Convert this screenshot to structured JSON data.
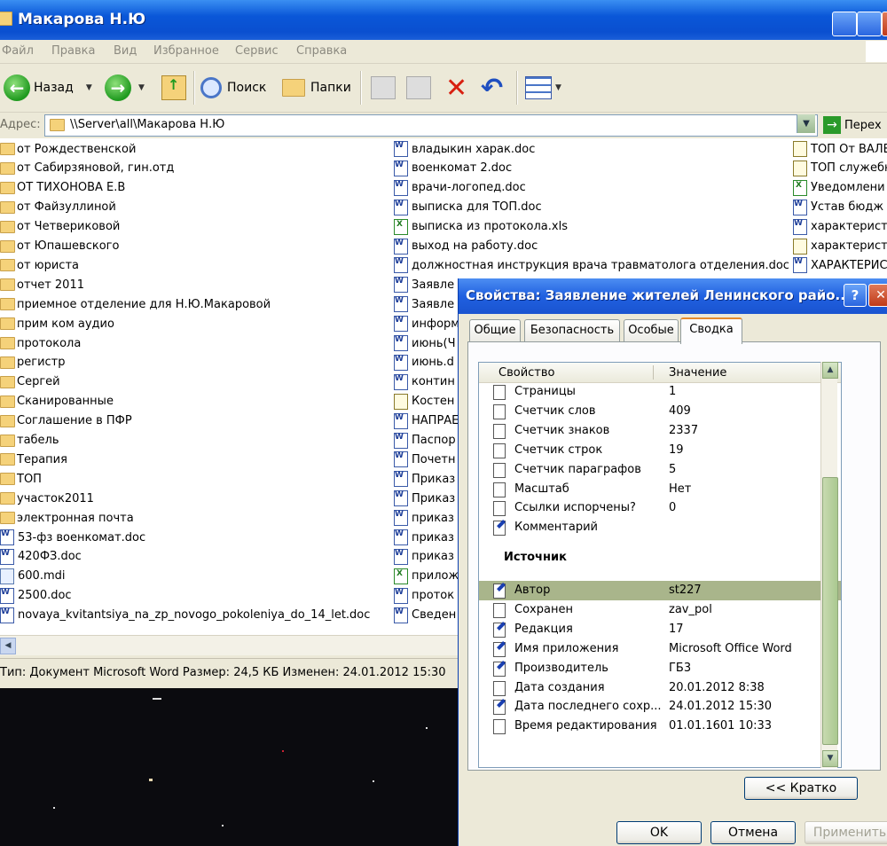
{
  "window": {
    "title": "Макарова Н.Ю"
  },
  "menu": [
    "Файл",
    "Правка",
    "Вид",
    "Избранное",
    "Сервис",
    "Справка"
  ],
  "toolbar": {
    "back": "Назад",
    "search": "Поиск",
    "folders": "Папки"
  },
  "address": {
    "label": "Адрес:",
    "path": "\\\\Server\\all\\Макарова Н.Ю",
    "go": "Перех"
  },
  "files_col1": [
    {
      "name": "от Рождественской",
      "type": "folder"
    },
    {
      "name": "от Сабирзяновой, гин.отд",
      "type": "folder"
    },
    {
      "name": "ОТ ТИХОНОВА Е.В",
      "type": "folder"
    },
    {
      "name": "от Файзуллиной",
      "type": "folder"
    },
    {
      "name": "от Четвериковой",
      "type": "folder"
    },
    {
      "name": "от Юпашевского",
      "type": "folder"
    },
    {
      "name": "от юриста",
      "type": "folder"
    },
    {
      "name": "отчет 2011",
      "type": "folder"
    },
    {
      "name": "приемное отделение для Н.Ю.Макаровой",
      "type": "folder"
    },
    {
      "name": "прим ком аудио",
      "type": "folder"
    },
    {
      "name": "протокола",
      "type": "folder"
    },
    {
      "name": "регистр",
      "type": "folder"
    },
    {
      "name": "Сергей",
      "type": "folder"
    },
    {
      "name": "Сканированные",
      "type": "folder"
    },
    {
      "name": "Соглашение в ПФР",
      "type": "folder"
    },
    {
      "name": "табель",
      "type": "folder"
    },
    {
      "name": "Терапия",
      "type": "folder"
    },
    {
      "name": "ТОП",
      "type": "folder"
    },
    {
      "name": "участок2011",
      "type": "folder"
    },
    {
      "name": "электронная почта",
      "type": "folder"
    },
    {
      "name": "53-фз военкомат.doc",
      "type": "doc"
    },
    {
      "name": "420ФЗ.doc",
      "type": "doc"
    },
    {
      "name": "600.mdi",
      "type": "mdi"
    },
    {
      "name": "2500.doc",
      "type": "doc"
    },
    {
      "name": "novaya_kvitantsiya_na_zp_novogo_pokoleniya_do_14_let.doc",
      "type": "doc"
    }
  ],
  "files_col2": [
    {
      "name": "владыкин харак.doc",
      "type": "doc"
    },
    {
      "name": "военкомат 2.doc",
      "type": "doc"
    },
    {
      "name": "врачи-логопед.doc",
      "type": "doc"
    },
    {
      "name": "выписка для ТОП.doc",
      "type": "doc"
    },
    {
      "name": "выписка из протокола.xls",
      "type": "xls"
    },
    {
      "name": "выход на работу.doc",
      "type": "doc"
    },
    {
      "name": "должностная инструкция врача травматолога отделения.doc",
      "type": "doc"
    },
    {
      "name": "Заявле",
      "type": "doc"
    },
    {
      "name": "Заявле",
      "type": "doc"
    },
    {
      "name": "информ",
      "type": "doc"
    },
    {
      "name": "июнь(Ч",
      "type": "doc"
    },
    {
      "name": "июнь.d",
      "type": "doc"
    },
    {
      "name": "контин",
      "type": "doc"
    },
    {
      "name": "Костен",
      "type": "txt"
    },
    {
      "name": "НАПРАЕ",
      "type": "doc"
    },
    {
      "name": "Паспор",
      "type": "doc"
    },
    {
      "name": "Почетн",
      "type": "doc"
    },
    {
      "name": "Приказ",
      "type": "doc"
    },
    {
      "name": "Приказ",
      "type": "doc"
    },
    {
      "name": "приказ",
      "type": "doc"
    },
    {
      "name": "приказ",
      "type": "doc"
    },
    {
      "name": "приказ",
      "type": "doc"
    },
    {
      "name": "прилож",
      "type": "xls"
    },
    {
      "name": "проток",
      "type": "doc"
    },
    {
      "name": "Сведен",
      "type": "doc"
    }
  ],
  "files_col3": [
    {
      "name": "ТОП От ВАЛЕ",
      "type": "txt"
    },
    {
      "name": "ТОП служебн",
      "type": "txt"
    },
    {
      "name": "Уведомлени",
      "type": "xls"
    },
    {
      "name": "Устав бюдж",
      "type": "doc"
    },
    {
      "name": "характерист",
      "type": "doc"
    },
    {
      "name": "характерист",
      "type": "txt"
    },
    {
      "name": "ХАРАКТЕРИС",
      "type": "doc"
    }
  ],
  "statusbar": "Тип: Документ Microsoft Word Размер: 24,5 КБ Изменен: 24.01.2012 15:30",
  "dialog": {
    "title": "Свойства: Заявление жителей Ленинского райо...",
    "help": "?",
    "close": "✕",
    "tabs": [
      "Общие",
      "Безопасность",
      "Особые",
      "Сводка"
    ],
    "active_tab": "Сводка",
    "columns": {
      "property": "Свойство",
      "value": "Значение"
    },
    "rows_top": [
      {
        "name": "Страницы",
        "value": "1",
        "editable": false
      },
      {
        "name": "Счетчик слов",
        "value": "409",
        "editable": false
      },
      {
        "name": "Счетчик знаков",
        "value": "2337",
        "editable": false
      },
      {
        "name": "Счетчик строк",
        "value": "19",
        "editable": false
      },
      {
        "name": "Счетчик параграфов",
        "value": "5",
        "editable": false
      },
      {
        "name": "Масштаб",
        "value": "Нет",
        "editable": false
      },
      {
        "name": "Ссылки испорчены?",
        "value": "0",
        "editable": false
      },
      {
        "name": "Комментарий",
        "value": "",
        "editable": true
      }
    ],
    "section": "Источник",
    "rows_source": [
      {
        "name": "Автор",
        "value": "st227",
        "editable": true,
        "selected": true
      },
      {
        "name": "Сохранен",
        "value": "zav_pol",
        "editable": false
      },
      {
        "name": "Редакция",
        "value": "17",
        "editable": true
      },
      {
        "name": "Имя приложения",
        "value": "Microsoft Office Word",
        "editable": true
      },
      {
        "name": "Производитель",
        "value": "ГБ3",
        "editable": true
      },
      {
        "name": "Дата создания",
        "value": "20.01.2012 8:38",
        "editable": false
      },
      {
        "name": "Дата последнего сохр...",
        "value": "24.01.2012 15:30",
        "editable": true
      },
      {
        "name": "Время редактирования",
        "value": "01.01.1601 10:33",
        "editable": false
      }
    ],
    "brief_button": "<< Кратко",
    "ok": "OK",
    "cancel": "Отмена",
    "apply": "Применить"
  },
  "colors": {
    "titlebar": "#0a57d8",
    "selection": "#a9b58b",
    "window_bg": "#ece9d8"
  }
}
